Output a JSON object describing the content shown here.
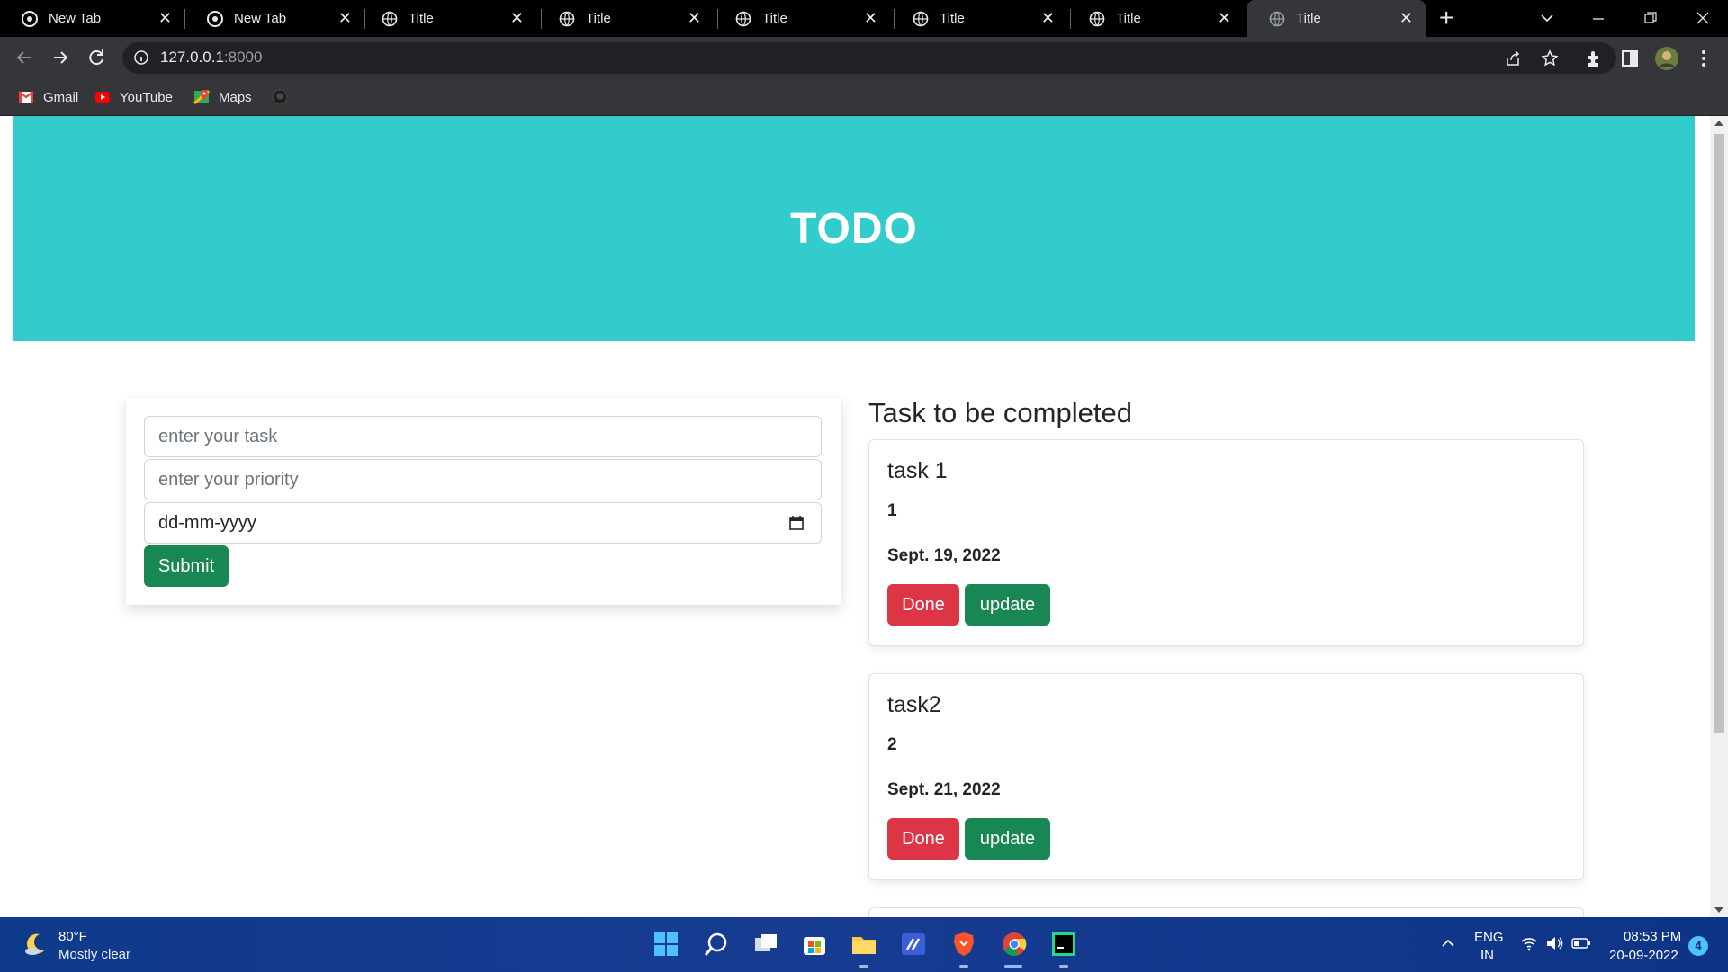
{
  "browser": {
    "tabs": [
      {
        "title": "New Tab",
        "icon": "chrome-icon",
        "active": false
      },
      {
        "title": "New Tab",
        "icon": "chrome-icon",
        "active": false
      },
      {
        "title": "Title",
        "icon": "globe-icon",
        "active": false
      },
      {
        "title": "Title",
        "icon": "globe-icon",
        "active": false
      },
      {
        "title": "Title",
        "icon": "globe-icon",
        "active": false
      },
      {
        "title": "Title",
        "icon": "globe-icon",
        "active": false
      },
      {
        "title": "Title",
        "icon": "globe-icon",
        "active": false
      },
      {
        "title": "Title",
        "icon": "globe-icon",
        "active": true
      }
    ],
    "address": {
      "host": "127.0.0.1",
      "port": ":8000"
    },
    "bookmarks": [
      {
        "label": "Gmail",
        "icon": "gmail-icon"
      },
      {
        "label": "YouTube",
        "icon": "youtube-icon"
      },
      {
        "label": "Maps",
        "icon": "maps-icon"
      },
      {
        "label": "",
        "icon": "github-icon"
      }
    ]
  },
  "page": {
    "header_title": "TODO",
    "form": {
      "task_placeholder": "enter your task",
      "priority_placeholder": "enter your priority",
      "date_placeholder": "dd-mm-yyyy",
      "submit_label": "Submit"
    },
    "list_title": "Task to be completed",
    "tasks": [
      {
        "name": "task 1",
        "priority": "1",
        "date": "Sept. 19, 2022",
        "done_label": "Done",
        "update_label": "update"
      },
      {
        "name": "task2",
        "priority": "2",
        "date": "Sept. 21, 2022",
        "done_label": "Done",
        "update_label": "update"
      }
    ]
  },
  "taskbar": {
    "weather_temp": "80°F",
    "weather_desc": "Mostly clear",
    "lang_top": "ENG",
    "lang_bottom": "IN",
    "time": "08:53 PM",
    "date": "20-09-2022",
    "notifications": "4"
  },
  "colors": {
    "header_bg": "#33cccc",
    "success": "#198754",
    "danger": "#dc3545",
    "taskbar": "#173c92"
  }
}
